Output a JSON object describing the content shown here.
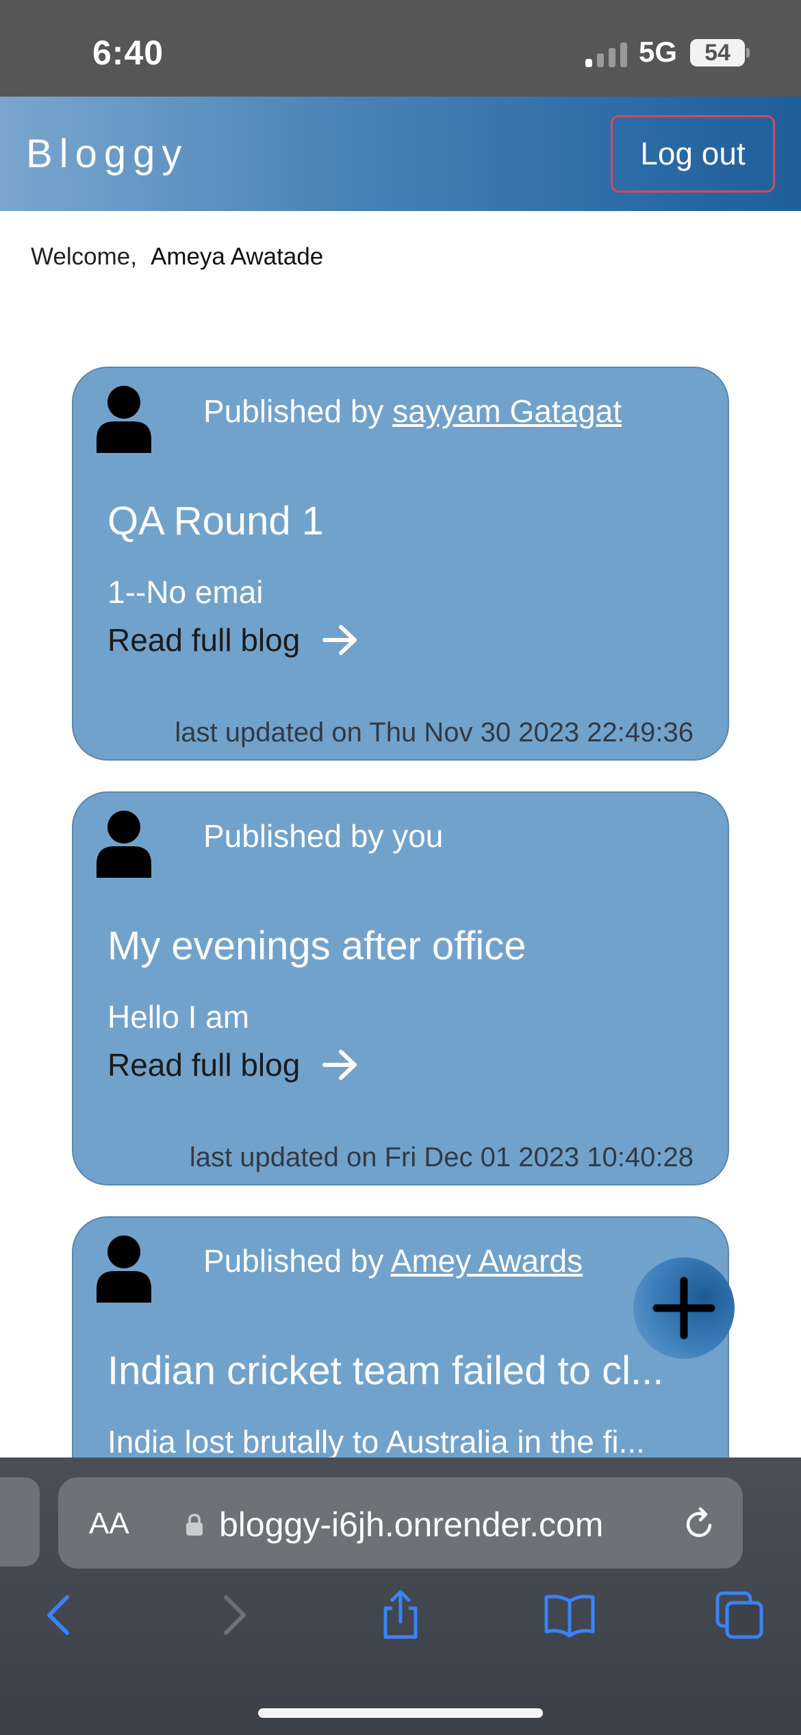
{
  "status": {
    "time": "6:40",
    "network": "5G",
    "battery": "54"
  },
  "header": {
    "brand": "Bloggy",
    "logout_label": "Log out"
  },
  "welcome": {
    "prefix": "Welcome,",
    "user": "Ameya Awatade"
  },
  "posts": [
    {
      "published_prefix": "Published by",
      "author": "sayyam Gatagat",
      "title": "QA Round 1",
      "excerpt": "1--No emai",
      "read_label": "Read full blog",
      "updated": "last updated on Thu Nov 30 2023 22:49:36"
    },
    {
      "published_prefix": "Published by you",
      "author": "",
      "title": "My evenings after office",
      "excerpt": "Hello I am",
      "read_label": "Read full blog",
      "updated": "last updated on Fri Dec 01 2023 10:40:28"
    },
    {
      "published_prefix": "Published by",
      "author": "Amey Awards",
      "title": "Indian cricket team failed to cl...",
      "excerpt": "India lost brutally to Australia in the fi..."
    }
  ],
  "browser": {
    "text_size_label": "AA",
    "url": "bloggy-i6jh.onrender.com"
  },
  "icons": {
    "avatar": "user-avatar-icon",
    "arrow": "arrow-right-icon",
    "fab": "plus-icon",
    "lock": "lock-icon",
    "reload": "reload-icon",
    "back": "chevron-left-icon",
    "forward": "chevron-right-icon",
    "share": "share-icon",
    "bookmarks": "book-icon",
    "tabs": "tabs-icon"
  },
  "colors": {
    "header_gradient_start": "#7aa6cf",
    "header_gradient_end": "#1f5f99",
    "card": "#71a2cb",
    "logout_border": "#d9475f",
    "ios_blue": "#3b82f6"
  }
}
